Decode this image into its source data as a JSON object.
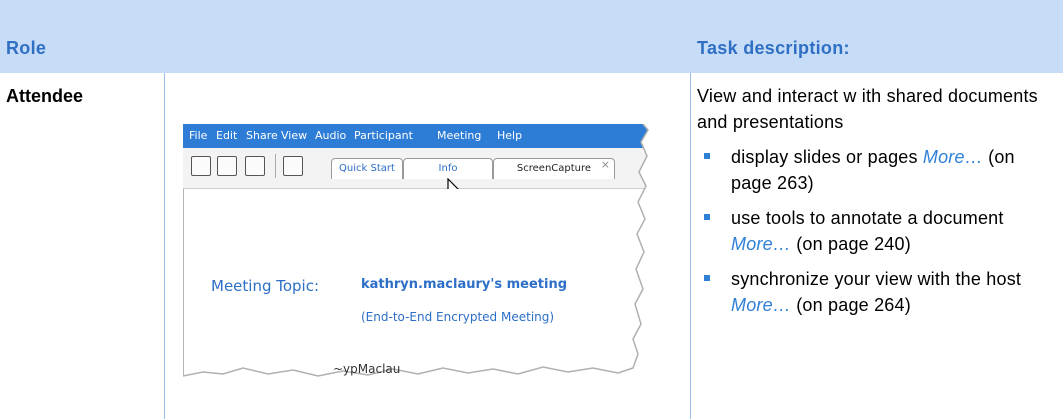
{
  "header": {
    "role_label": "Role",
    "task_label": "Task description:"
  },
  "row": {
    "role": "Attendee",
    "intro": "View and interact w ith shared documents and presentations",
    "bullets": [
      {
        "text": "display slides or pages ",
        "link": "More…",
        "ref": " (on page 263)"
      },
      {
        "text": "use tools to annotate a document ",
        "link": "More…",
        "ref": " (on page 240)"
      },
      {
        "text": "synchronize your view with the host ",
        "link": "More…",
        "ref": " (on page 264)"
      }
    ]
  },
  "screenshot": {
    "menu": [
      "File",
      "Edit",
      "Share",
      "View",
      "Audio",
      "Participant",
      "Meeting",
      "Help"
    ],
    "tabs": [
      "Quick Start",
      "Info",
      "ScreenCapture"
    ],
    "tab_close": "×",
    "meeting_topic_label": "Meeting Topic:",
    "meeting_topic_value": "kathryn.maclaury's meeting",
    "meeting_subtitle": "(End-to-End Encrypted Meeting)",
    "cut_text": "~ypMaclau"
  },
  "colors": {
    "header_band": "#c6dcf7",
    "header_text": "#2f6fc4",
    "link": "#2f80d7",
    "menubar": "#2d7dd6"
  },
  "icons": [
    "page-icon",
    "window-icon",
    "window-icon",
    "annotate-icon",
    "cursor-icon",
    "bullet-square-icon"
  ]
}
